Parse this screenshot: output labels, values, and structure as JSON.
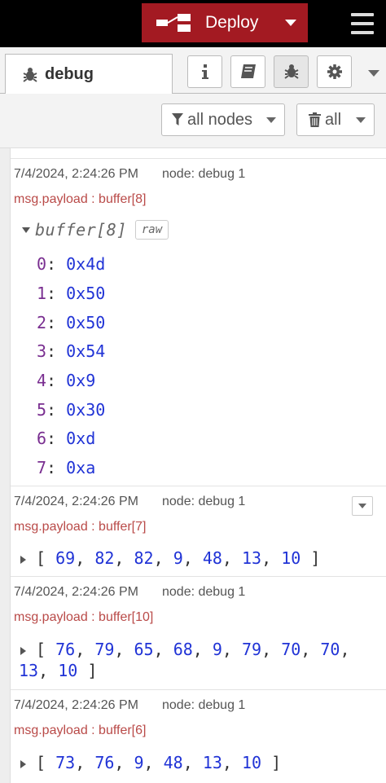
{
  "header": {
    "deploy_label": "Deploy"
  },
  "sidebar": {
    "tab_label": "debug",
    "filter_label": "all nodes",
    "clear_label": "all"
  },
  "messages": [
    {
      "timestamp": "7/4/2024, 2:24:26 PM",
      "node": "node: debug 1",
      "topic": "msg.payload : buffer[8]",
      "expanded": true,
      "tree_label": "buffer[8]",
      "raw_label": "raw",
      "rows": [
        {
          "index": "0",
          "value": "0x4d"
        },
        {
          "index": "1",
          "value": "0x50"
        },
        {
          "index": "2",
          "value": "0x50"
        },
        {
          "index": "3",
          "value": "0x54"
        },
        {
          "index": "4",
          "value": "0x9"
        },
        {
          "index": "5",
          "value": "0x30"
        },
        {
          "index": "6",
          "value": "0xd"
        },
        {
          "index": "7",
          "value": "0xa"
        }
      ]
    },
    {
      "timestamp": "7/4/2024, 2:24:26 PM",
      "node": "node: debug 1",
      "topic": "msg.payload : buffer[7]",
      "values": [
        "69",
        "82",
        "82",
        "9",
        "48",
        "13",
        "10"
      ]
    },
    {
      "timestamp": "7/4/2024, 2:24:26 PM",
      "node": "node: debug 1",
      "topic": "msg.payload : buffer[10]",
      "values": [
        "76",
        "79",
        "65",
        "68",
        "9",
        "79",
        "70",
        "70",
        "13",
        "10"
      ]
    },
    {
      "timestamp": "7/4/2024, 2:24:26 PM",
      "node": "node: debug 1",
      "topic": "msg.payload : buffer[6]",
      "values": [
        "73",
        "76",
        "9",
        "48",
        "13",
        "10"
      ]
    }
  ],
  "icons": {
    "deploy": "deploy-flow-icon",
    "menu": "hamburger-icon",
    "debug": "bug-icon",
    "info": "info-icon",
    "help": "book-icon",
    "config": "gear-icon",
    "filter": "funnel-icon",
    "clear": "trash-icon"
  },
  "colors": {
    "deploy_bg": "#a31a22",
    "header_bg": "#000000",
    "topic": "#b94a48",
    "index": "#792e90",
    "number": "#2033d6"
  }
}
